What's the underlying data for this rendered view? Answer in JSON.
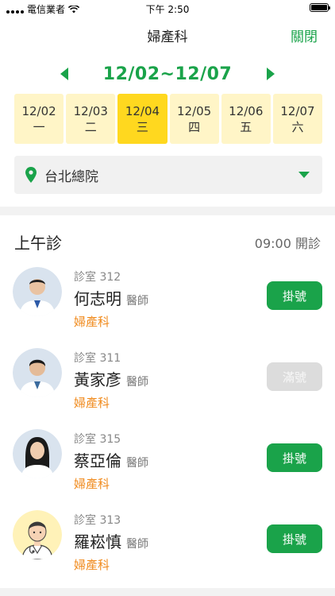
{
  "status_bar": {
    "carrier": "電信業者",
    "time": "下午 2:50"
  },
  "nav": {
    "title": "婦產科",
    "close_label": "關閉"
  },
  "week": {
    "range": "12/02~12/07"
  },
  "days": [
    {
      "date": "12/02",
      "weekday": "一",
      "selected": false
    },
    {
      "date": "12/03",
      "weekday": "二",
      "selected": false
    },
    {
      "date": "12/04",
      "weekday": "三",
      "selected": true
    },
    {
      "date": "12/05",
      "weekday": "四",
      "selected": false
    },
    {
      "date": "12/06",
      "weekday": "五",
      "selected": false
    },
    {
      "date": "12/07",
      "weekday": "六",
      "selected": false
    }
  ],
  "location": {
    "value": "台北總院"
  },
  "session": {
    "title": "上午診",
    "start_time": "09:00 開診"
  },
  "doctors": [
    {
      "room": "診室 312",
      "name": "何志明",
      "title": "醫師",
      "department": "婦產科",
      "button_label": "掛號",
      "available": true
    },
    {
      "room": "診室 311",
      "name": "黃家彥",
      "title": "醫師",
      "department": "婦產科",
      "button_label": "滿號",
      "available": false
    },
    {
      "room": "診室 315",
      "name": "蔡亞倫",
      "title": "醫師",
      "department": "婦產科",
      "button_label": "掛號",
      "available": true
    },
    {
      "room": "診室 313",
      "name": "羅崧慎",
      "title": "醫師",
      "department": "婦產科",
      "button_label": "掛號",
      "available": true
    }
  ],
  "colors": {
    "accent": "#1aa34a",
    "day_chip": "#fff5c7",
    "day_selected": "#ffd81f",
    "department": "#f08a1c"
  }
}
